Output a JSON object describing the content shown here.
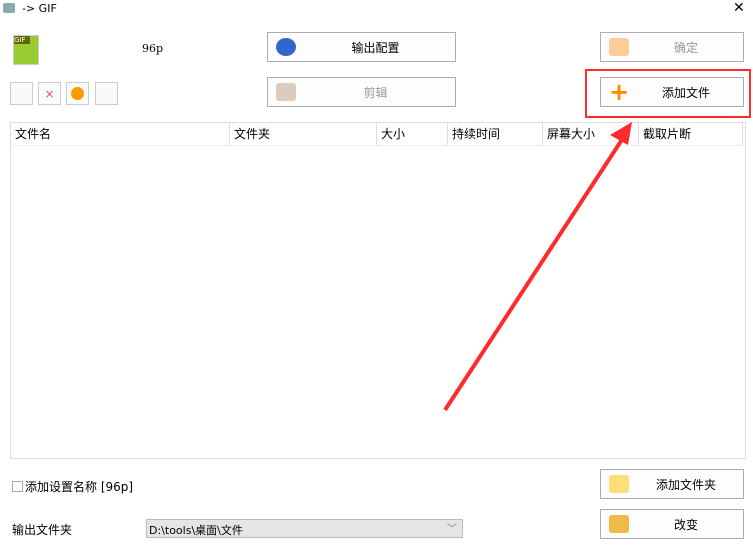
{
  "window": {
    "title": "-> GIF"
  },
  "preset": {
    "name": "96p"
  },
  "buttons": {
    "output_config": "输出配置",
    "confirm": "确定",
    "edit": "剪辑",
    "add_file": "添加文件",
    "add_folder": "添加文件夹",
    "change": "改变"
  },
  "table": {
    "columns": [
      "文件名",
      "文件夹",
      "大小",
      "持续时间",
      "屏幕大小",
      "截取片断"
    ],
    "rows": []
  },
  "options": {
    "add_preset_name_label": "添加设置名称 [96p]",
    "add_preset_name_checked": false
  },
  "output": {
    "label": "输出文件夹",
    "path": "D:\\tools\\桌面\\文件"
  },
  "colors": {
    "highlight": "#ff2a2a"
  }
}
